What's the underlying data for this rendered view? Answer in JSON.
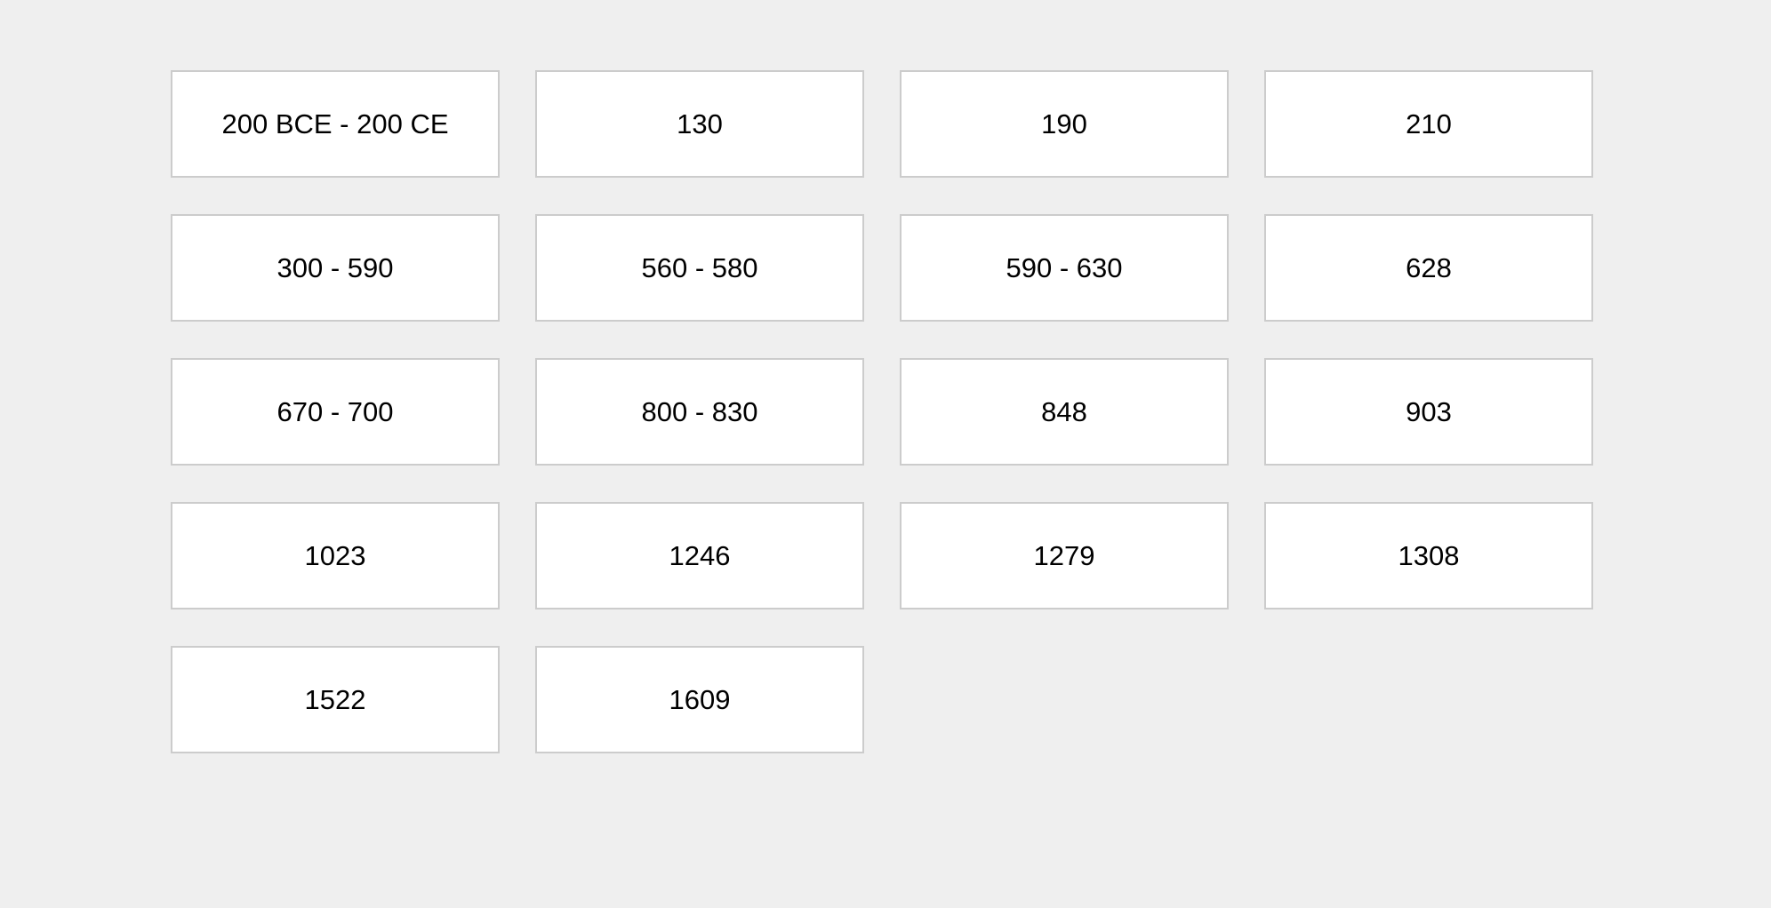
{
  "cards": [
    {
      "label": "200 BCE - 200 CE"
    },
    {
      "label": "130"
    },
    {
      "label": "190"
    },
    {
      "label": "210"
    },
    {
      "label": "300 - 590"
    },
    {
      "label": "560 - 580"
    },
    {
      "label": "590 - 630"
    },
    {
      "label": "628"
    },
    {
      "label": "670 - 700"
    },
    {
      "label": "800 - 830"
    },
    {
      "label": "848"
    },
    {
      "label": "903"
    },
    {
      "label": "1023"
    },
    {
      "label": "1246"
    },
    {
      "label": "1279"
    },
    {
      "label": "1308"
    },
    {
      "label": "1522"
    },
    {
      "label": "1609"
    }
  ],
  "colors": {
    "background": "#efefef",
    "card_background": "#ffffff",
    "card_border": "#cccccc",
    "text": "#000000"
  }
}
